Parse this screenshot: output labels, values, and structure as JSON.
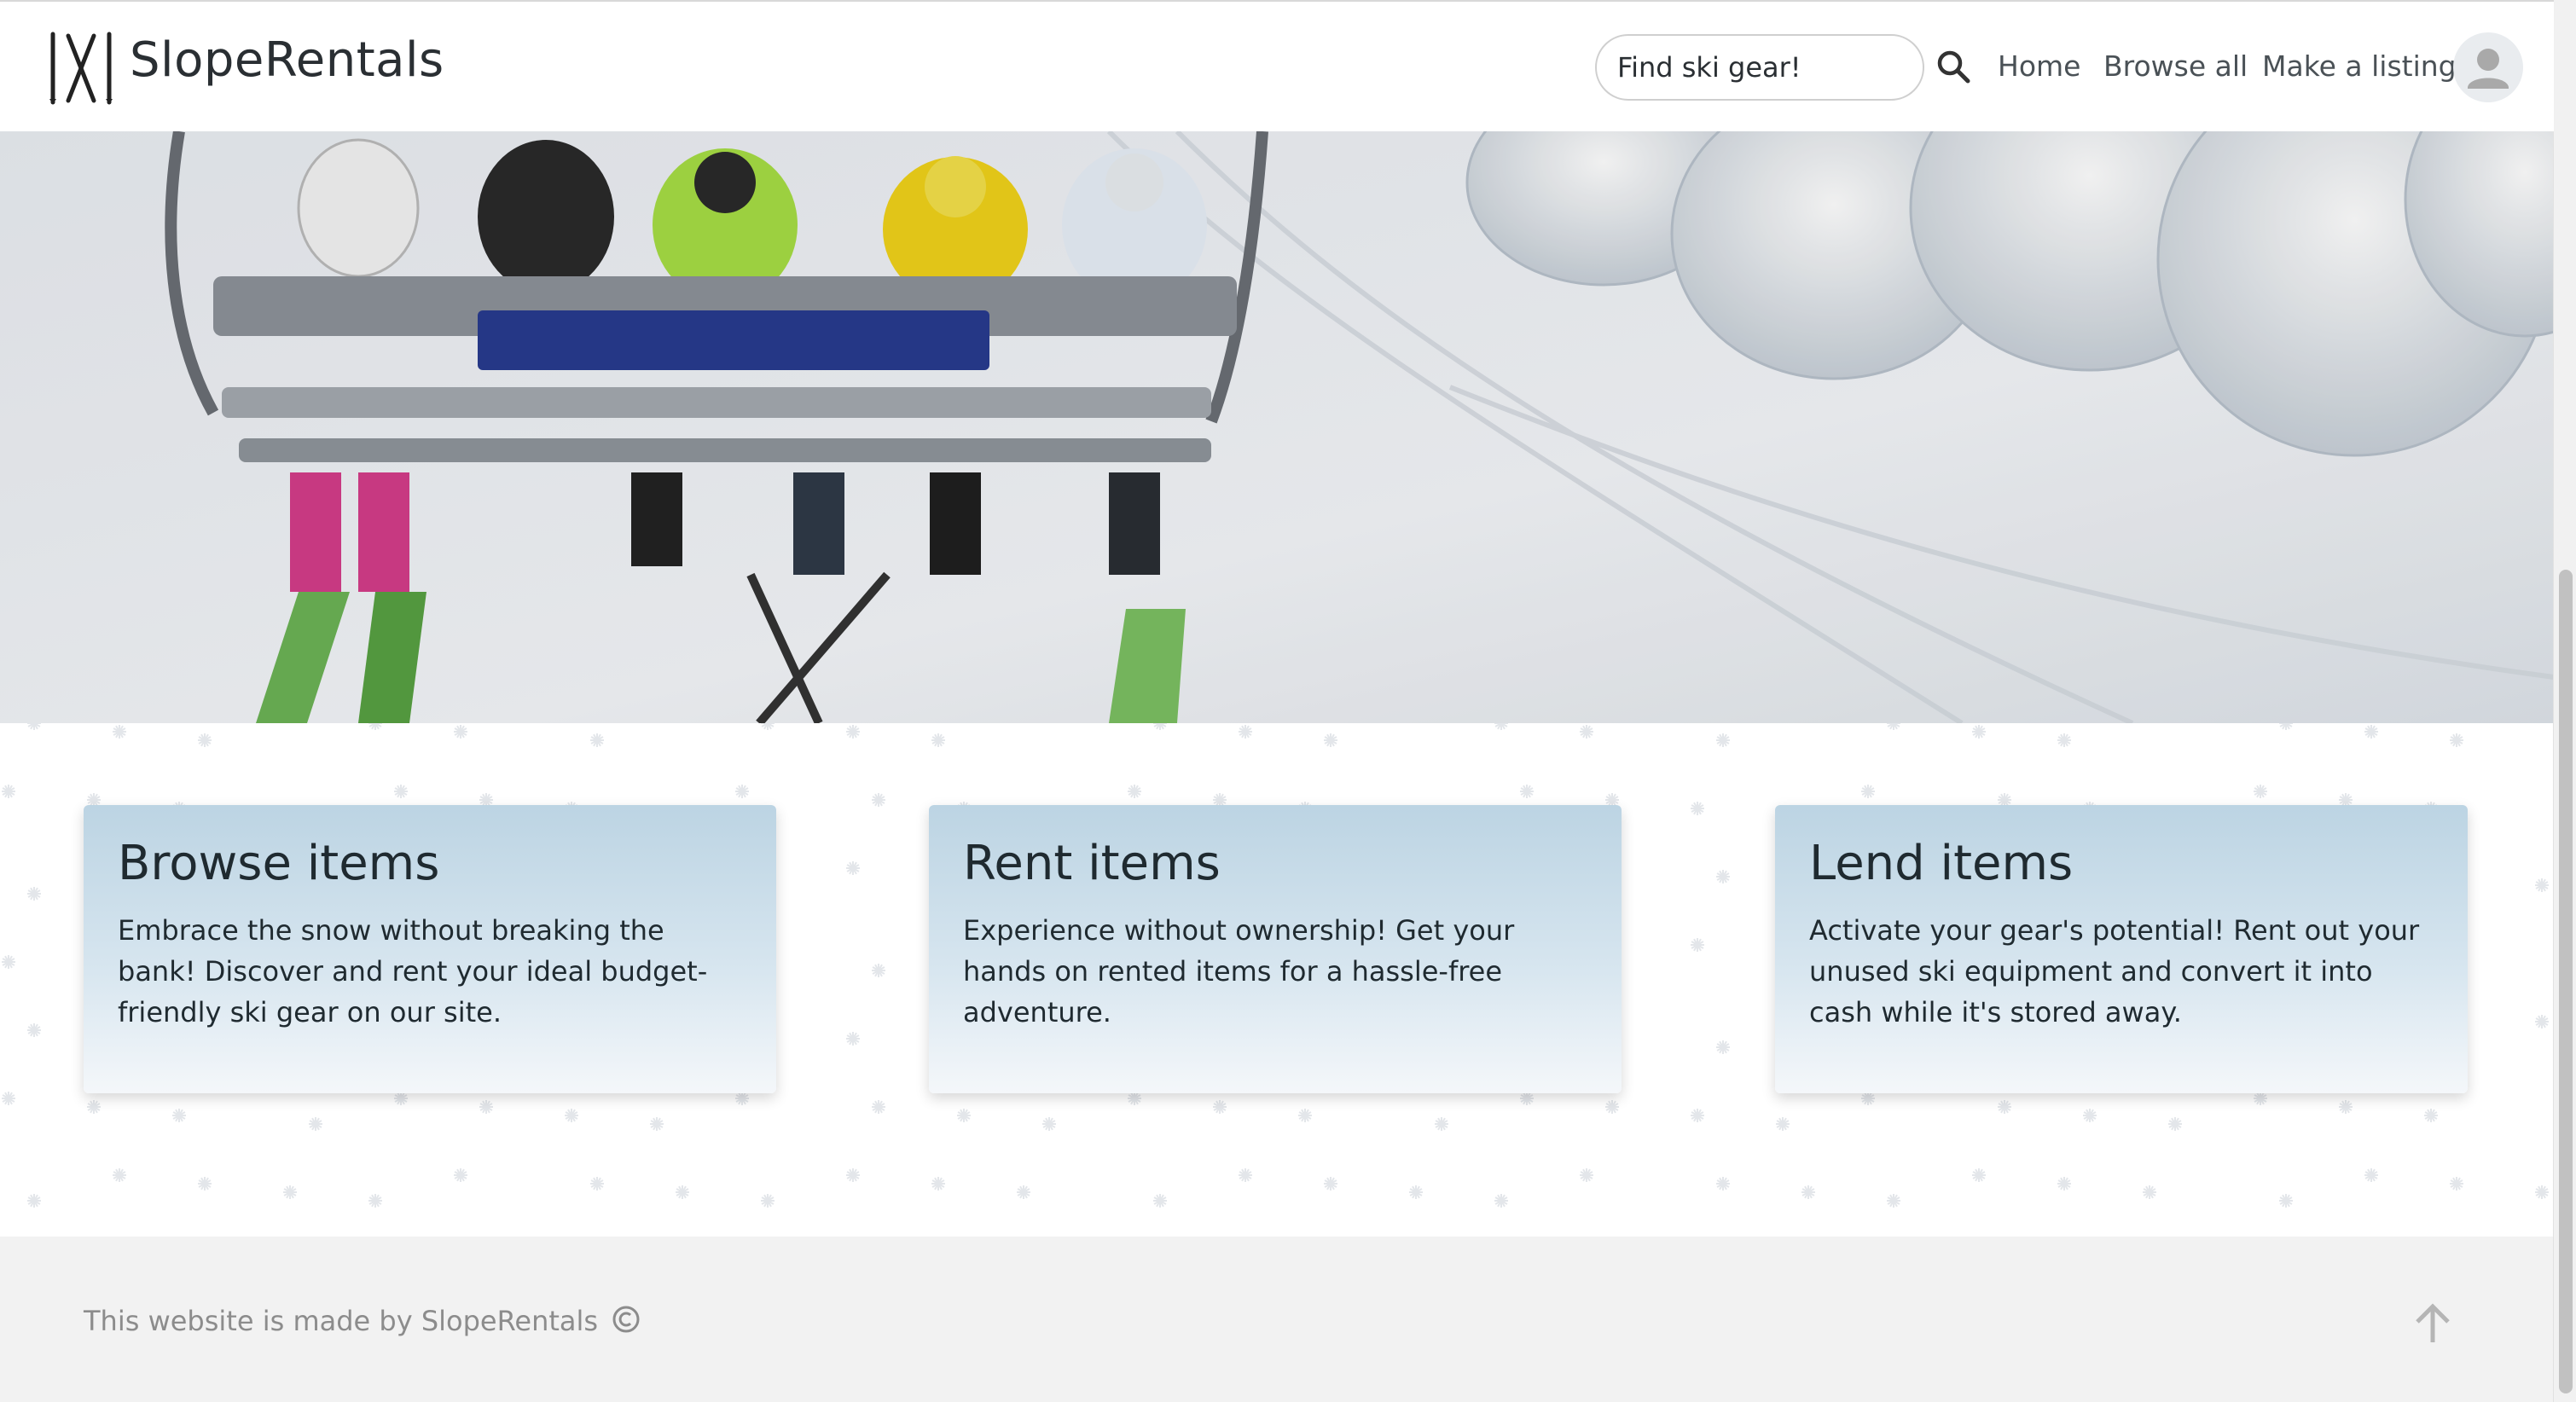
{
  "header": {
    "brand": "SlopeRentals",
    "search": {
      "placeholder": "Find ski gear!"
    },
    "nav": {
      "home": "Home",
      "browse_all": "Browse all",
      "make_listing": "Make a listing"
    }
  },
  "icons": {
    "logo": "crossed-skis-icon",
    "search": "search-icon",
    "avatar": "user-avatar-icon",
    "copyright": "copyright-icon",
    "scroll_top": "arrow-up-icon"
  },
  "features": [
    {
      "title": "Browse items",
      "text": "Embrace the snow without breaking the bank! Discover and rent your ideal budget-friendly ski gear on our site."
    },
    {
      "title": "Rent items",
      "text": "Experience without ownership! Get your hands on rented items for a hassle-free adventure."
    },
    {
      "title": "Lend items",
      "text": "Activate your gear's potential! Rent out your unused ski equipment and convert it into cash while it's stored away."
    }
  ],
  "footer": {
    "text": "This website is made by SlopeRentals"
  },
  "colors": {
    "card_top": "#bcd4e3",
    "card_bottom": "#f4f7fa",
    "footer_bg": "#f2f2f2",
    "text_dark": "#1f2a30"
  }
}
